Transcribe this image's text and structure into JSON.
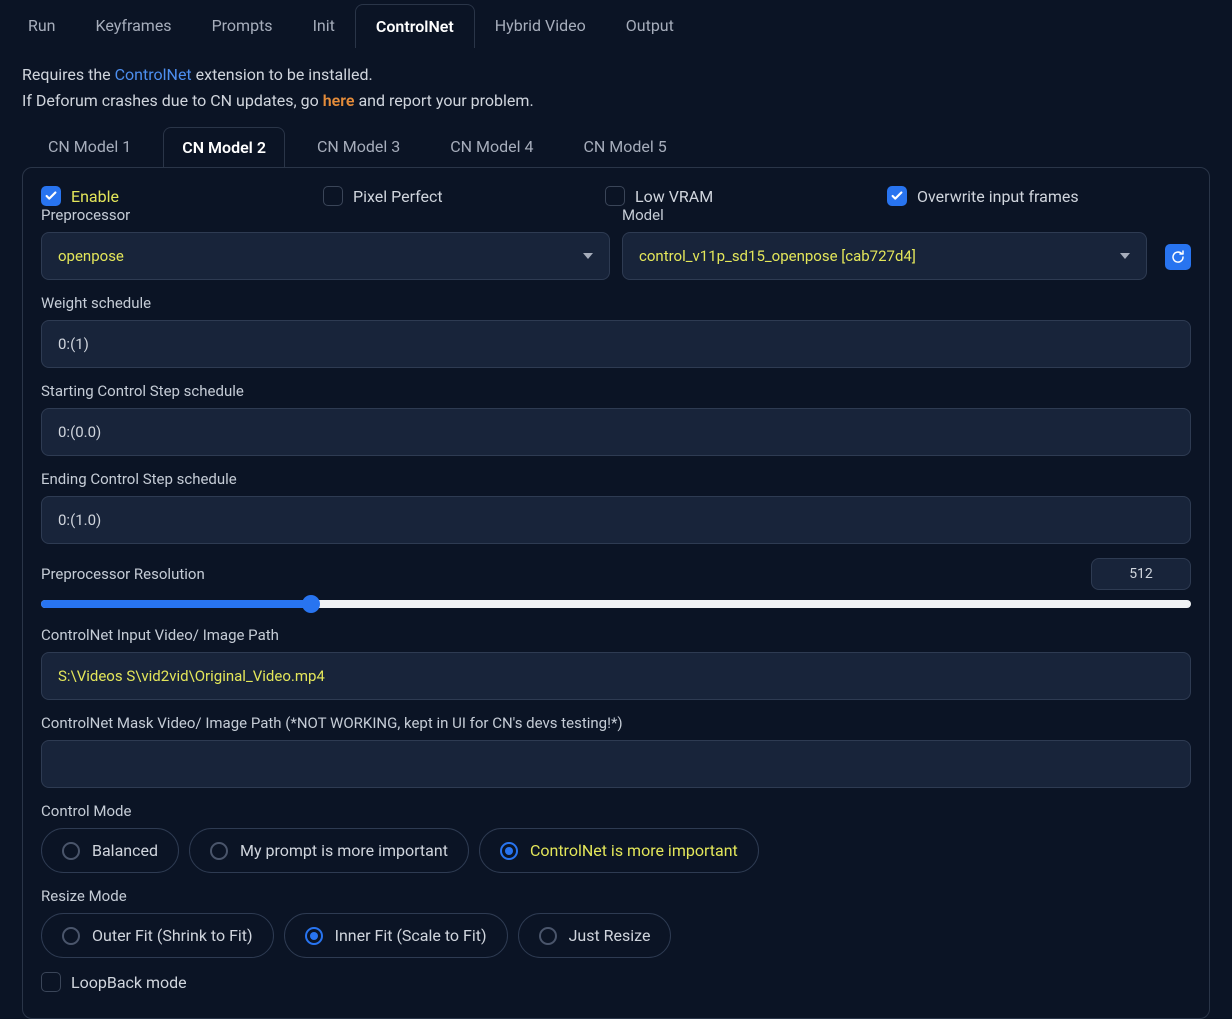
{
  "top_tabs": {
    "items": [
      "Run",
      "Keyframes",
      "Prompts",
      "Init",
      "ControlNet",
      "Hybrid Video",
      "Output"
    ],
    "active": "ControlNet"
  },
  "info": {
    "line1_pre": "Requires the ",
    "line1_link": "ControlNet",
    "line1_post": " extension to be installed.",
    "line2_pre": "If Deforum crashes due to CN updates, go ",
    "line2_link": "here",
    "line2_post": " and report your problem."
  },
  "sub_tabs": {
    "items": [
      "CN Model 1",
      "CN Model 2",
      "CN Model 3",
      "CN Model 4",
      "CN Model 5"
    ],
    "active": "CN Model 2"
  },
  "checks": {
    "enable": "Enable",
    "pixel_perfect": "Pixel Perfect",
    "low_vram": "Low VRAM",
    "overwrite": "Overwrite input frames"
  },
  "preproc": {
    "label": "Preprocessor",
    "value": "openpose"
  },
  "model": {
    "label": "Model",
    "value": "control_v11p_sd15_openpose [cab727d4]"
  },
  "weight": {
    "label": "Weight schedule",
    "value": "0:(1)"
  },
  "start_step": {
    "label": "Starting Control Step schedule",
    "value": "0:(0.0)"
  },
  "end_step": {
    "label": "Ending Control Step schedule",
    "value": "0:(1.0)"
  },
  "resolution": {
    "label": "Preprocessor Resolution",
    "value": "512"
  },
  "input_path": {
    "label": "ControlNet Input Video/ Image Path",
    "value": "S:\\Videos S\\vid2vid\\Original_Video.mp4"
  },
  "mask_path": {
    "label": "ControlNet Mask Video/ Image Path (*NOT WORKING, kept in UI for CN's devs testing!*)",
    "value": ""
  },
  "control_mode": {
    "label": "Control Mode",
    "options": [
      "Balanced",
      "My prompt is more important",
      "ControlNet is more important"
    ],
    "selected": 2
  },
  "resize_mode": {
    "label": "Resize Mode",
    "options": [
      "Outer Fit (Shrink to Fit)",
      "Inner Fit (Scale to Fit)",
      "Just Resize"
    ],
    "selected": 1
  },
  "loopback": {
    "label": "LoopBack mode"
  }
}
